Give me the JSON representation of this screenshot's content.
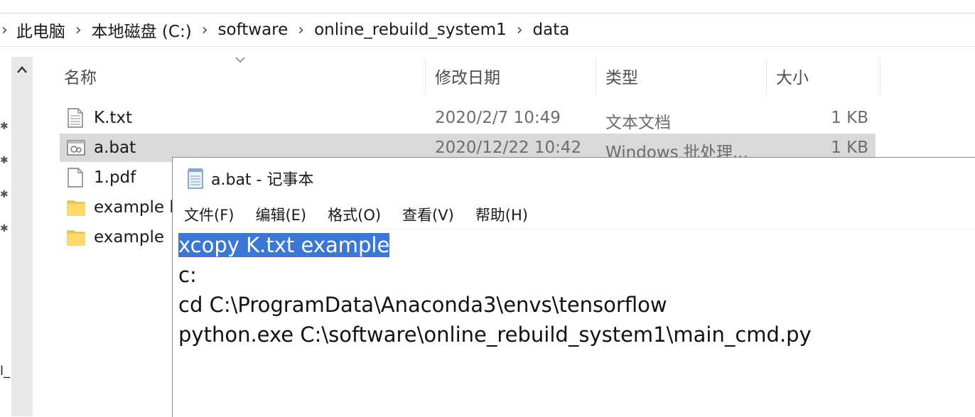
{
  "breadcrumb": {
    "items": [
      "此电脑",
      "本地磁盘 (C:)",
      "software",
      "online_rebuild_system1",
      "data"
    ]
  },
  "columns": {
    "name": "名称",
    "date": "修改日期",
    "type": "类型",
    "size": "大小"
  },
  "files": [
    {
      "name": "K.txt",
      "date": "2020/2/7 10:49",
      "type": "文本文档",
      "size": "1 KB",
      "icon": "text-file-icon"
    },
    {
      "name": "a.bat",
      "date": "2020/12/22 10:42",
      "type": "Windows 批处理...",
      "size": "1 KB",
      "icon": "batch-file-icon"
    },
    {
      "name": "1.pdf",
      "date": "",
      "type": "",
      "size": "",
      "icon": "pdf-file-icon"
    },
    {
      "name": "example l",
      "date": "",
      "type": "",
      "size": "",
      "icon": "folder-icon"
    },
    {
      "name": "example",
      "date": "",
      "type": "",
      "size": "",
      "icon": "folder-icon"
    }
  ],
  "notepad": {
    "title": "a.bat - 记事本",
    "menu": [
      "文件(F)",
      "编辑(E)",
      "格式(O)",
      "查看(V)",
      "帮助(H)"
    ],
    "lines": [
      "xcopy K.txt example",
      "c:",
      "cd C:\\ProgramData\\Anaconda3\\envs\\tensorflow",
      "python.exe C:\\software\\online_rebuild_system1\\main_cmd.py"
    ]
  },
  "colors": {
    "selection": "#3b78d6",
    "row_selected": "#d9d9d9",
    "folder": "#f4c84c"
  }
}
